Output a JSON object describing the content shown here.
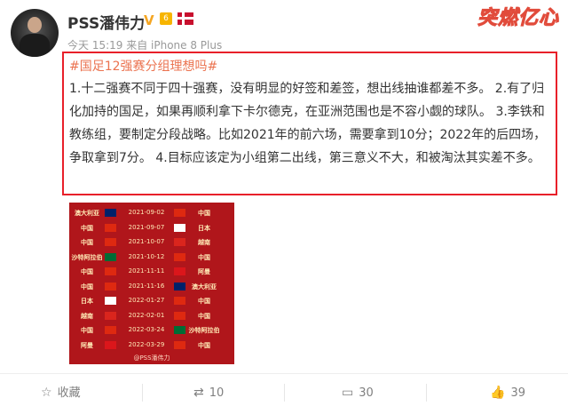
{
  "post": {
    "username": "PSS潘伟力",
    "vip_badge": "V",
    "level_badge": "6",
    "meta": "今天 15:19 来自 iPhone 8 Plus",
    "watermark": "突燃亿心",
    "hashtag": "#国足12强赛分组理想吗#",
    "content": "1.十二强赛不同于四十强赛，没有明显的好签和差签，想出线抽谁都差不多。 2.有了归化加持的国足，如果再顺利拿下卡尔德克，在亚洲范围也是不容小觑的球队。 3.李铁和教练组，要制定分段战略。比如2021年的前六场，需要拿到10分；2022年的后四场，争取拿到7分。 4.目标应该定为小组第二出线，第三意义不大，和被淘汰其实差不多。"
  },
  "schedule_image": {
    "rows": [
      {
        "team1": "澳大利亚",
        "date": "2021-09-02",
        "team2": "中国",
        "c1": "#012169",
        "c2": "#de2910"
      },
      {
        "team1": "中国",
        "date": "2021-09-07",
        "team2": "日本",
        "c1": "#de2910",
        "c2": "#ffffff"
      },
      {
        "team1": "中国",
        "date": "2021-10-07",
        "team2": "越南",
        "c1": "#de2910",
        "c2": "#da251d"
      },
      {
        "team1": "沙特阿拉伯",
        "date": "2021-10-12",
        "team2": "中国",
        "c1": "#006c35",
        "c2": "#de2910"
      },
      {
        "team1": "中国",
        "date": "2021-11-11",
        "team2": "阿曼",
        "c1": "#de2910",
        "c2": "#db161b"
      },
      {
        "team1": "中国",
        "date": "2021-11-16",
        "team2": "澳大利亚",
        "c1": "#de2910",
        "c2": "#012169"
      },
      {
        "team1": "日本",
        "date": "2022-01-27",
        "team2": "中国",
        "c1": "#ffffff",
        "c2": "#de2910"
      },
      {
        "team1": "越南",
        "date": "2022-02-01",
        "team2": "中国",
        "c1": "#da251d",
        "c2": "#de2910"
      },
      {
        "team1": "中国",
        "date": "2022-03-24",
        "team2": "沙特阿拉伯",
        "c1": "#de2910",
        "c2": "#006c35"
      },
      {
        "team1": "阿曼",
        "date": "2022-03-29",
        "team2": "中国",
        "c1": "#db161b",
        "c2": "#de2910"
      }
    ],
    "caption": "@PSS潘伟力"
  },
  "actions": {
    "collect_label": "收藏",
    "repost_count": "10",
    "comment_count": "30",
    "like_count": "39"
  }
}
